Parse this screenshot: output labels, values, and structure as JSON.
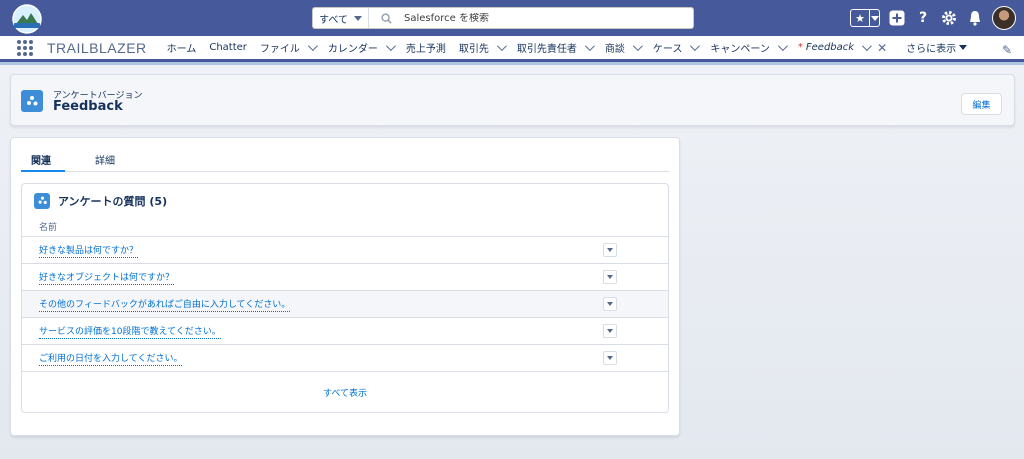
{
  "header": {
    "search_scope": "すべて",
    "search_placeholder": "Salesforce を検索"
  },
  "nav": {
    "app_name": "TRAILBLAZER",
    "items": [
      {
        "label": "ホーム",
        "dropdown": false
      },
      {
        "label": "Chatter",
        "dropdown": false
      },
      {
        "label": "ファイル",
        "dropdown": true
      },
      {
        "label": "カレンダー",
        "dropdown": true
      },
      {
        "label": "売上予測",
        "dropdown": false
      },
      {
        "label": "取引先",
        "dropdown": true
      },
      {
        "label": "取引先責任者",
        "dropdown": true
      },
      {
        "label": "商談",
        "dropdown": true
      },
      {
        "label": "ケース",
        "dropdown": true
      },
      {
        "label": "キャンペーン",
        "dropdown": true
      }
    ],
    "active_tab": {
      "marker": "*",
      "label": "Feedback"
    },
    "more_label": "さらに表示"
  },
  "record": {
    "eyebrow": "アンケートバージョン",
    "title": "Feedback",
    "edit_label": "編集"
  },
  "tabs": [
    {
      "label": "関連",
      "active": true
    },
    {
      "label": "詳細",
      "active": false
    }
  ],
  "related": {
    "title": "アンケートの質問 (5)",
    "column_header": "名前",
    "rows": [
      "好きな製品は何ですか？",
      "好きなオブジェクトは何ですか？",
      "その他のフィードバックがあればご自由に入力してください。",
      "サービスの評価を10段階で教えてください。",
      "ご利用の日付を入力してください。"
    ],
    "highlighted_row": 2,
    "view_all": "すべて表示"
  },
  "colors": {
    "header_bg": "#46599a",
    "accent": "#1589ee",
    "link": "#0070d2",
    "icon_bg": "#3e8dd8"
  }
}
